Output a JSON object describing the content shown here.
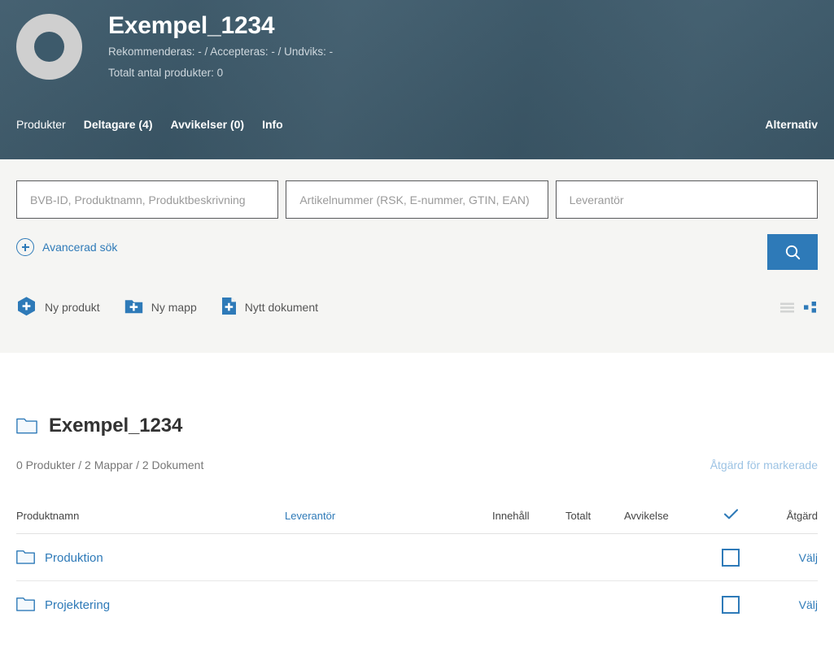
{
  "header": {
    "logo_alt": "ring-logo",
    "project_title": "Exempel_1234",
    "stats_line": "Rekommenderas: -  /  Accepteras: -  /  Undviks: -",
    "total_line": "Totalt antal produkter: 0",
    "nav": [
      {
        "label": "Produkter",
        "current": true
      },
      {
        "label": "Deltagare (4)",
        "current": false
      },
      {
        "label": "Avvikelser (0)",
        "current": false
      },
      {
        "label": "Info",
        "current": false
      }
    ],
    "options_label": "Alternativ",
    "background_color": "#3d5a6b"
  },
  "search": {
    "field_product_placeholder": "BVB-ID, Produktnamn, Produktbeskrivning",
    "field_product_value": "",
    "field_article_placeholder": "Artikelnummer (RSK, E-nummer, GTIN, EAN)",
    "field_article_value": "",
    "field_supplier_placeholder": "Leverantör",
    "field_supplier_value": "",
    "advanced_label": "Avancerad sök",
    "search_button_icon": "search-icon",
    "accent_color": "#2e7ab8",
    "panel_color": "#f5f5f3"
  },
  "actions": [
    {
      "label": "Ny produkt",
      "icon": "hexagon-plus-icon"
    },
    {
      "label": "Ny mapp",
      "icon": "folder-plus-icon"
    },
    {
      "label": "Nytt dokument",
      "icon": "document-plus-icon"
    }
  ],
  "view_toggles": [
    {
      "icon": "list-view-icon",
      "active": false
    },
    {
      "icon": "grid-view-icon",
      "active": true
    }
  ],
  "folder": {
    "icon": "folder-outline-icon",
    "title": "Exempel_1234",
    "counts": "0 Produkter / 2 Mappar / 2 Dokument",
    "bulk_action_label": "Åtgärd för markerade"
  },
  "table": {
    "headers": {
      "name": "Produktnamn",
      "supplier": "Leverantör",
      "content": "Innehåll",
      "total": "Totalt",
      "deviation": "Avvikelse",
      "check": "check-icon",
      "action": "Åtgärd"
    },
    "rows": [
      {
        "icon": "folder-outline-icon",
        "name": "Produktion",
        "supplier": "",
        "content": "",
        "total": "",
        "deviation": "",
        "checked": false,
        "action_label": "Välj"
      },
      {
        "icon": "folder-outline-icon",
        "name": "Projektering",
        "supplier": "",
        "content": "",
        "total": "",
        "deviation": "",
        "checked": false,
        "action_label": "Välj"
      }
    ]
  }
}
